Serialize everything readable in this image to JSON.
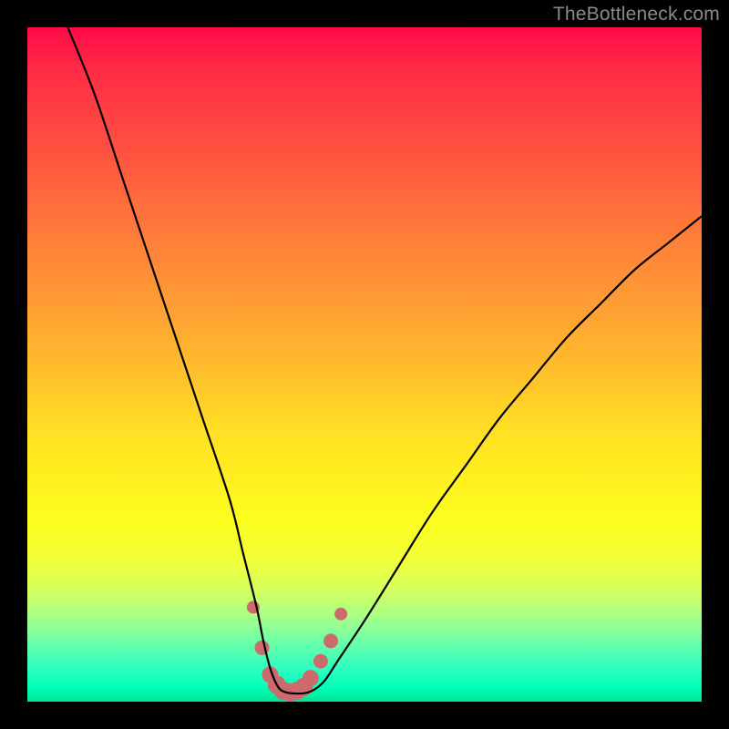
{
  "watermark": "TheBottleneck.com",
  "colors": {
    "frame": "#000000",
    "curve": "#000000",
    "markers": "#cc6b6b",
    "grad_top": "#ff0a46",
    "grad_bottom": "#00e297"
  },
  "chart_data": {
    "type": "line",
    "title": "",
    "xlabel": "",
    "ylabel": "",
    "xlim": [
      0,
      100
    ],
    "ylim": [
      0,
      100
    ],
    "grid": false,
    "series": [
      {
        "name": "bottleneck-curve",
        "x": [
          6,
          10,
          14,
          18,
          22,
          26,
          30,
          32,
          34,
          35,
          36,
          37,
          38,
          40,
          42,
          44,
          46,
          50,
          55,
          60,
          65,
          70,
          75,
          80,
          85,
          90,
          95,
          100
        ],
        "y": [
          100,
          90,
          78,
          66,
          54,
          42,
          30,
          22,
          14,
          9,
          5,
          2.5,
          1.5,
          1.2,
          1.5,
          3,
          6,
          12,
          20,
          28,
          35,
          42,
          48,
          54,
          59,
          64,
          68,
          72
        ]
      }
    ],
    "markers": {
      "name": "highlight-points",
      "x": [
        33.5,
        34.8,
        36,
        37,
        38,
        39,
        40,
        41,
        42,
        43.5,
        45,
        46.5
      ],
      "y": [
        14,
        8,
        4,
        2.5,
        1.6,
        1.4,
        1.6,
        2.2,
        3.5,
        6,
        9,
        13
      ],
      "r": [
        7,
        8,
        9,
        10,
        10,
        10,
        10,
        10,
        9,
        8,
        8,
        7
      ]
    }
  }
}
